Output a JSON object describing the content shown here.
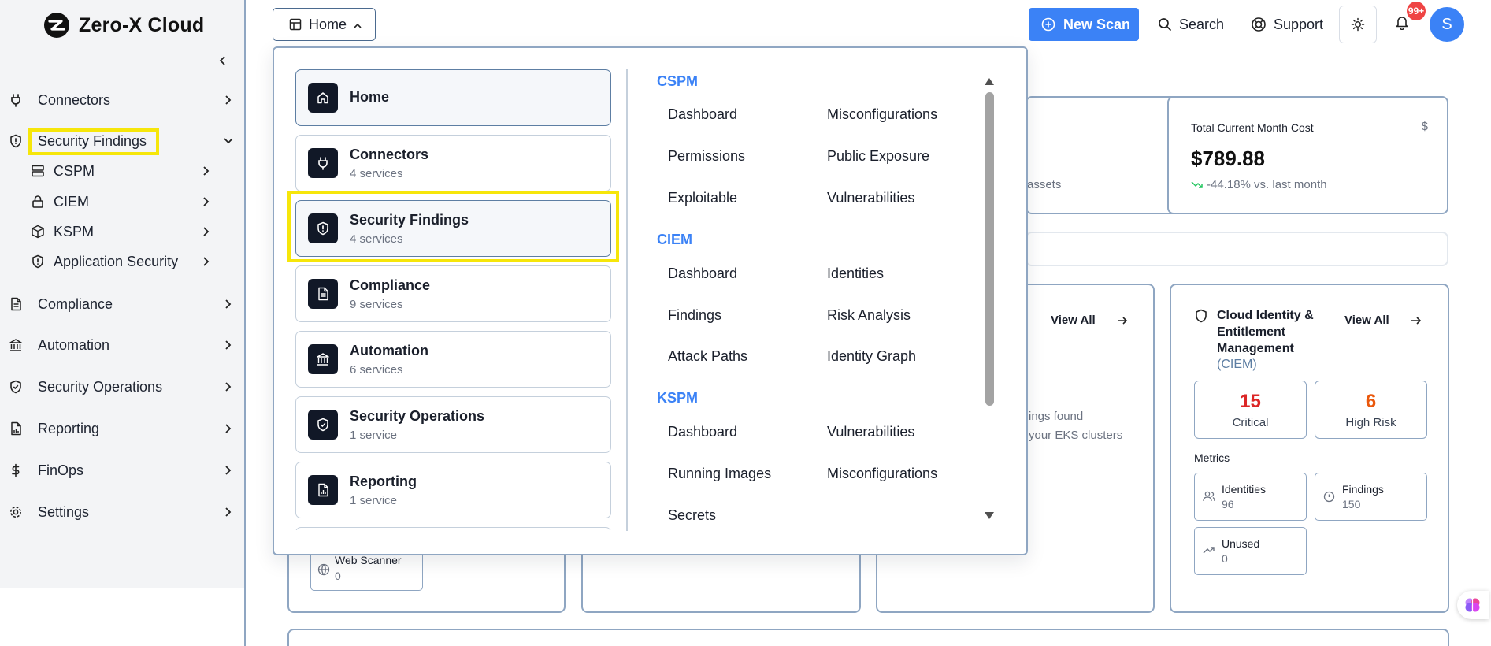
{
  "app": {
    "title": "Zero-X Cloud"
  },
  "sidebar": {
    "items": [
      {
        "label": "Connectors",
        "icon": "plug-icon"
      },
      {
        "label": "Security Findings",
        "icon": "shield-alert-icon",
        "expanded": true,
        "children": [
          {
            "label": "CSPM",
            "icon": "server-icon"
          },
          {
            "label": "CIEM",
            "icon": "lock-icon"
          },
          {
            "label": "KSPM",
            "icon": "package-icon"
          },
          {
            "label": "Application Security",
            "icon": "shield-alert-icon"
          }
        ]
      },
      {
        "label": "Compliance",
        "icon": "file-text-icon"
      },
      {
        "label": "Automation",
        "icon": "landmark-icon"
      },
      {
        "label": "Security Operations",
        "icon": "shield-check-icon"
      },
      {
        "label": "Reporting",
        "icon": "report-icon"
      },
      {
        "label": "FinOps",
        "icon": "dollar-icon"
      },
      {
        "label": "Settings",
        "icon": "gear-icon"
      }
    ]
  },
  "topbar": {
    "home_label": "Home",
    "new_scan_label": "New Scan",
    "search_label": "Search",
    "support_label": "Support",
    "notification_count": "99+",
    "avatar_initial": "S"
  },
  "dropdown": {
    "categories": [
      {
        "name": "Home",
        "count": ""
      },
      {
        "name": "Connectors",
        "count": "4 services"
      },
      {
        "name": "Security Findings",
        "count": "4 services"
      },
      {
        "name": "Compliance",
        "count": "9 services"
      },
      {
        "name": "Automation",
        "count": "6 services"
      },
      {
        "name": "Security Operations",
        "count": "1 service"
      },
      {
        "name": "Reporting",
        "count": "1 service"
      }
    ],
    "groups": [
      {
        "title": "CSPM",
        "items": [
          "Dashboard",
          "Misconfigurations",
          "Permissions",
          "Public Exposure",
          "Exploitable",
          "Vulnerabilities"
        ]
      },
      {
        "title": "CIEM",
        "items": [
          "Dashboard",
          "Identities",
          "Findings",
          "Risk Analysis",
          "Attack Paths",
          "Identity Graph"
        ]
      },
      {
        "title": "KSPM",
        "items": [
          "Dashboard",
          "Vulnerabilities",
          "Running Images",
          "Misconfigurations",
          "Secrets"
        ]
      }
    ]
  },
  "dashboard": {
    "cost_card": {
      "title": "Total Current Month Cost",
      "value": "$789.88",
      "trend": "-44.18% vs. last month"
    },
    "assets_fragment": "assets",
    "eks_fragment_1": "ings found",
    "eks_fragment_2": "your EKS clusters",
    "view_all_label": "View All",
    "ciem_card": {
      "title": "Cloud Identity & Entitlement Management",
      "subtitle": "(CIEM)",
      "critical_value": "15",
      "critical_label": "Critical",
      "high_value": "6",
      "high_label": "High Risk",
      "metrics_label": "Metrics",
      "identities_label": "Identities",
      "identities_value": "96",
      "findings_label": "Findings",
      "findings_value": "150",
      "unused_label": "Unused",
      "unused_value": "0"
    },
    "web_scanner": {
      "label": "Web Scanner",
      "value": "0"
    }
  },
  "colors": {
    "accent": "#3b82f6",
    "highlight": "#f6e60a",
    "critical": "#dc2626",
    "high": "#ea580c"
  }
}
